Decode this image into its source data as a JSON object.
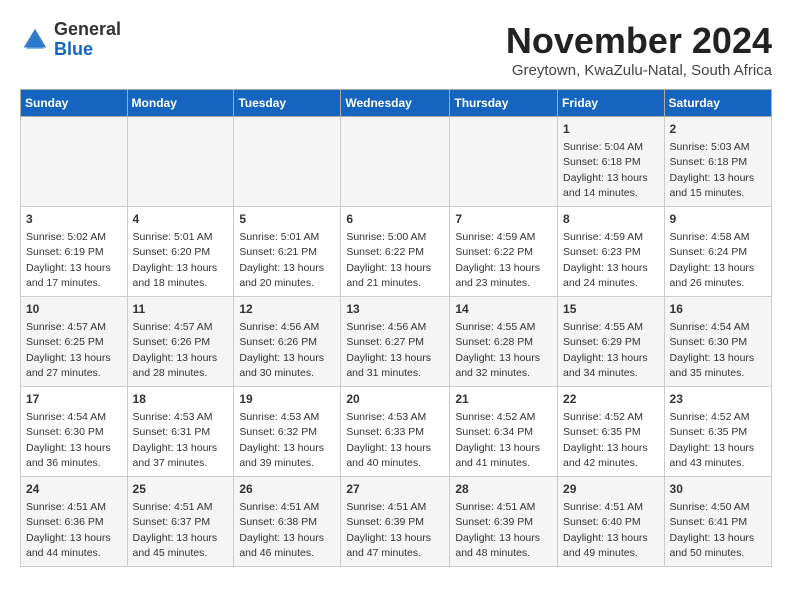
{
  "logo": {
    "general": "General",
    "blue": "Blue"
  },
  "title": "November 2024",
  "subtitle": "Greytown, KwaZulu-Natal, South Africa",
  "days_of_week": [
    "Sunday",
    "Monday",
    "Tuesday",
    "Wednesday",
    "Thursday",
    "Friday",
    "Saturday"
  ],
  "weeks": [
    [
      {
        "day": "",
        "info": ""
      },
      {
        "day": "",
        "info": ""
      },
      {
        "day": "",
        "info": ""
      },
      {
        "day": "",
        "info": ""
      },
      {
        "day": "",
        "info": ""
      },
      {
        "day": "1",
        "info": "Sunrise: 5:04 AM\nSunset: 6:18 PM\nDaylight: 13 hours and 14 minutes."
      },
      {
        "day": "2",
        "info": "Sunrise: 5:03 AM\nSunset: 6:18 PM\nDaylight: 13 hours and 15 minutes."
      }
    ],
    [
      {
        "day": "3",
        "info": "Sunrise: 5:02 AM\nSunset: 6:19 PM\nDaylight: 13 hours and 17 minutes."
      },
      {
        "day": "4",
        "info": "Sunrise: 5:01 AM\nSunset: 6:20 PM\nDaylight: 13 hours and 18 minutes."
      },
      {
        "day": "5",
        "info": "Sunrise: 5:01 AM\nSunset: 6:21 PM\nDaylight: 13 hours and 20 minutes."
      },
      {
        "day": "6",
        "info": "Sunrise: 5:00 AM\nSunset: 6:22 PM\nDaylight: 13 hours and 21 minutes."
      },
      {
        "day": "7",
        "info": "Sunrise: 4:59 AM\nSunset: 6:22 PM\nDaylight: 13 hours and 23 minutes."
      },
      {
        "day": "8",
        "info": "Sunrise: 4:59 AM\nSunset: 6:23 PM\nDaylight: 13 hours and 24 minutes."
      },
      {
        "day": "9",
        "info": "Sunrise: 4:58 AM\nSunset: 6:24 PM\nDaylight: 13 hours and 26 minutes."
      }
    ],
    [
      {
        "day": "10",
        "info": "Sunrise: 4:57 AM\nSunset: 6:25 PM\nDaylight: 13 hours and 27 minutes."
      },
      {
        "day": "11",
        "info": "Sunrise: 4:57 AM\nSunset: 6:26 PM\nDaylight: 13 hours and 28 minutes."
      },
      {
        "day": "12",
        "info": "Sunrise: 4:56 AM\nSunset: 6:26 PM\nDaylight: 13 hours and 30 minutes."
      },
      {
        "day": "13",
        "info": "Sunrise: 4:56 AM\nSunset: 6:27 PM\nDaylight: 13 hours and 31 minutes."
      },
      {
        "day": "14",
        "info": "Sunrise: 4:55 AM\nSunset: 6:28 PM\nDaylight: 13 hours and 32 minutes."
      },
      {
        "day": "15",
        "info": "Sunrise: 4:55 AM\nSunset: 6:29 PM\nDaylight: 13 hours and 34 minutes."
      },
      {
        "day": "16",
        "info": "Sunrise: 4:54 AM\nSunset: 6:30 PM\nDaylight: 13 hours and 35 minutes."
      }
    ],
    [
      {
        "day": "17",
        "info": "Sunrise: 4:54 AM\nSunset: 6:30 PM\nDaylight: 13 hours and 36 minutes."
      },
      {
        "day": "18",
        "info": "Sunrise: 4:53 AM\nSunset: 6:31 PM\nDaylight: 13 hours and 37 minutes."
      },
      {
        "day": "19",
        "info": "Sunrise: 4:53 AM\nSunset: 6:32 PM\nDaylight: 13 hours and 39 minutes."
      },
      {
        "day": "20",
        "info": "Sunrise: 4:53 AM\nSunset: 6:33 PM\nDaylight: 13 hours and 40 minutes."
      },
      {
        "day": "21",
        "info": "Sunrise: 4:52 AM\nSunset: 6:34 PM\nDaylight: 13 hours and 41 minutes."
      },
      {
        "day": "22",
        "info": "Sunrise: 4:52 AM\nSunset: 6:35 PM\nDaylight: 13 hours and 42 minutes."
      },
      {
        "day": "23",
        "info": "Sunrise: 4:52 AM\nSunset: 6:35 PM\nDaylight: 13 hours and 43 minutes."
      }
    ],
    [
      {
        "day": "24",
        "info": "Sunrise: 4:51 AM\nSunset: 6:36 PM\nDaylight: 13 hours and 44 minutes."
      },
      {
        "day": "25",
        "info": "Sunrise: 4:51 AM\nSunset: 6:37 PM\nDaylight: 13 hours and 45 minutes."
      },
      {
        "day": "26",
        "info": "Sunrise: 4:51 AM\nSunset: 6:38 PM\nDaylight: 13 hours and 46 minutes."
      },
      {
        "day": "27",
        "info": "Sunrise: 4:51 AM\nSunset: 6:39 PM\nDaylight: 13 hours and 47 minutes."
      },
      {
        "day": "28",
        "info": "Sunrise: 4:51 AM\nSunset: 6:39 PM\nDaylight: 13 hours and 48 minutes."
      },
      {
        "day": "29",
        "info": "Sunrise: 4:51 AM\nSunset: 6:40 PM\nDaylight: 13 hours and 49 minutes."
      },
      {
        "day": "30",
        "info": "Sunrise: 4:50 AM\nSunset: 6:41 PM\nDaylight: 13 hours and 50 minutes."
      }
    ]
  ]
}
